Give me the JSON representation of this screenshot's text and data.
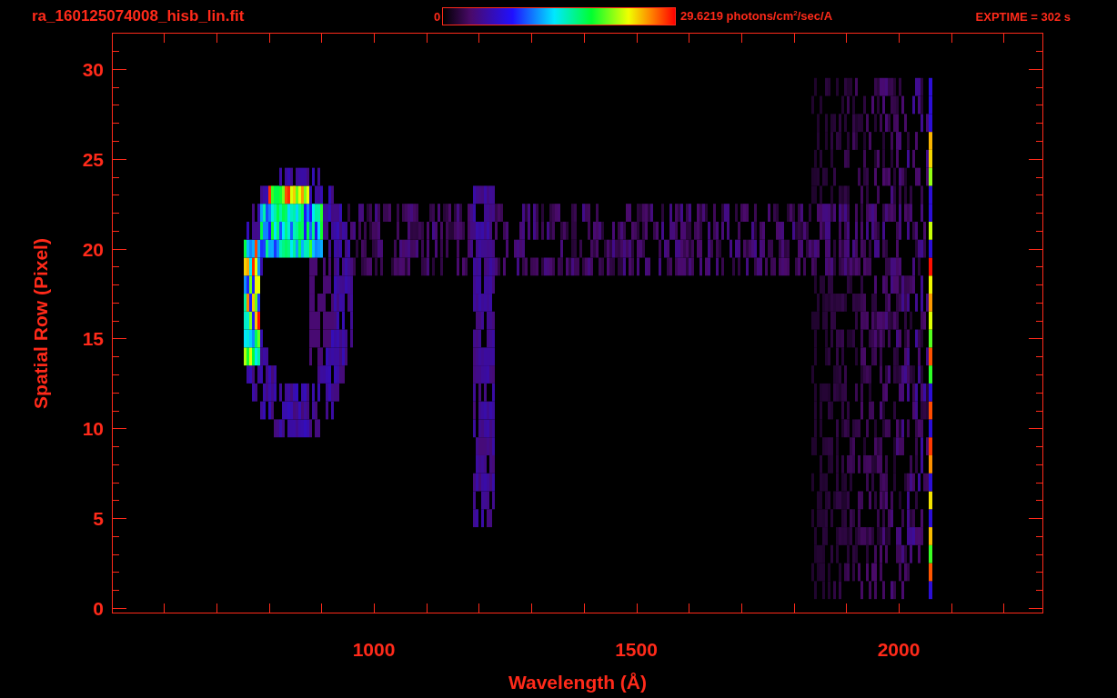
{
  "title": "ra_160125074008_hisb_lin.fit",
  "colorbar": {
    "min_label": "0",
    "max_label": "29.6219 photons/cm$^{2}$/sec/A"
  },
  "exposure": "EXPTIME = 302 s",
  "plot": {
    "x_axis": {
      "label": "Wavelength (Å)",
      "ticks": [
        "1000",
        "1500",
        "2000"
      ]
    },
    "y_axis": {
      "label": "Spatial Row (Pixel)",
      "ticks": [
        "30",
        "25",
        "20",
        "15",
        "10",
        "5",
        "0"
      ]
    }
  }
}
